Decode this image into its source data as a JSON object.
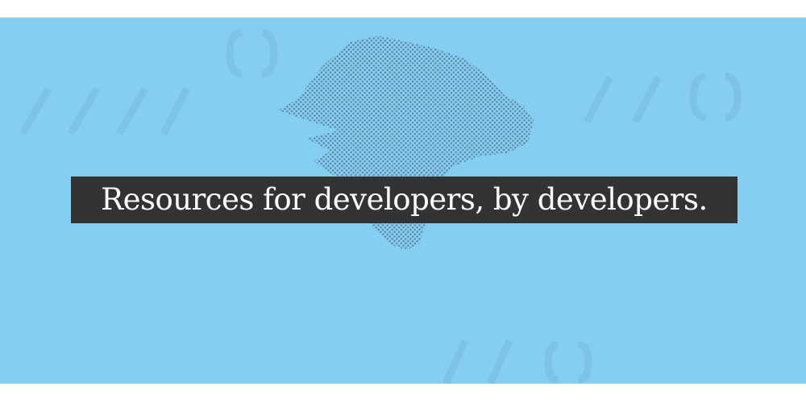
{
  "hero": {
    "headline": "Resources for developers, by developers.",
    "background_color": "#83cef1",
    "headline_background_color": "#333333",
    "headline_text_color": "#ffffff",
    "illustration": "dinosaur-head-halftone-icon",
    "decorations": [
      "slashes-pattern-icon",
      "braces-pattern-icon"
    ]
  }
}
